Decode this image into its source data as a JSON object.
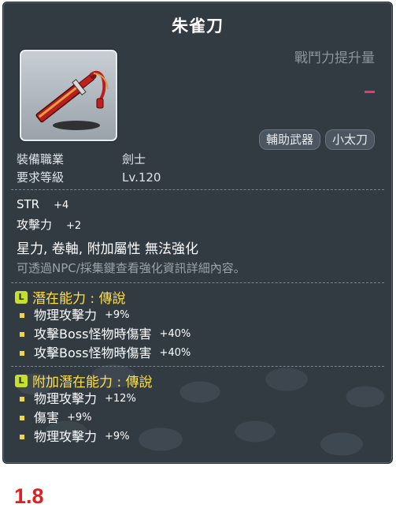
{
  "item": {
    "name": "朱雀刀",
    "power_label": "戰鬥力提升量",
    "power_value": "-",
    "tags": [
      "輔助武器",
      "小太刀"
    ],
    "requirements": [
      {
        "key": "裝備職業",
        "value": "劍士"
      },
      {
        "key": "要求等級",
        "value": "Lv.120"
      }
    ],
    "stats": [
      {
        "key": "STR",
        "value": "+4"
      },
      {
        "key": "攻擊力",
        "value": "+2"
      }
    ],
    "flags": "星力, 卷軸, 附加屬性 無法強化",
    "note": "可透過NPC/採集鍵查看強化資訊詳細內容。"
  },
  "potential": {
    "badge": "L",
    "title": "潛在能力 : 傳說",
    "lines": [
      {
        "name": "物理攻擊力",
        "value": "+9%"
      },
      {
        "name": "攻擊Boss怪物時傷害",
        "value": "+40%"
      },
      {
        "name": "攻擊Boss怪物時傷害",
        "value": "+40%"
      }
    ]
  },
  "additional_potential": {
    "badge": "L",
    "title": "附加潛在能力 : 傳說",
    "lines": [
      {
        "name": "物理攻擊力",
        "value": "+12%"
      },
      {
        "name": "傷害",
        "value": "+9%"
      },
      {
        "name": "物理攻擊力",
        "value": "+9%"
      }
    ]
  },
  "footer_text": "1.8",
  "colors": {
    "panel_bg": "#323a42",
    "potential_yellow": "#ffe048",
    "legendary_badge": "#c7df2e",
    "power_pink": "#ff2f6e",
    "footer_red": "#e0201e"
  },
  "icons": [
    "red-tassel-dagger-icon",
    "legendary-L-badge-icon"
  ]
}
